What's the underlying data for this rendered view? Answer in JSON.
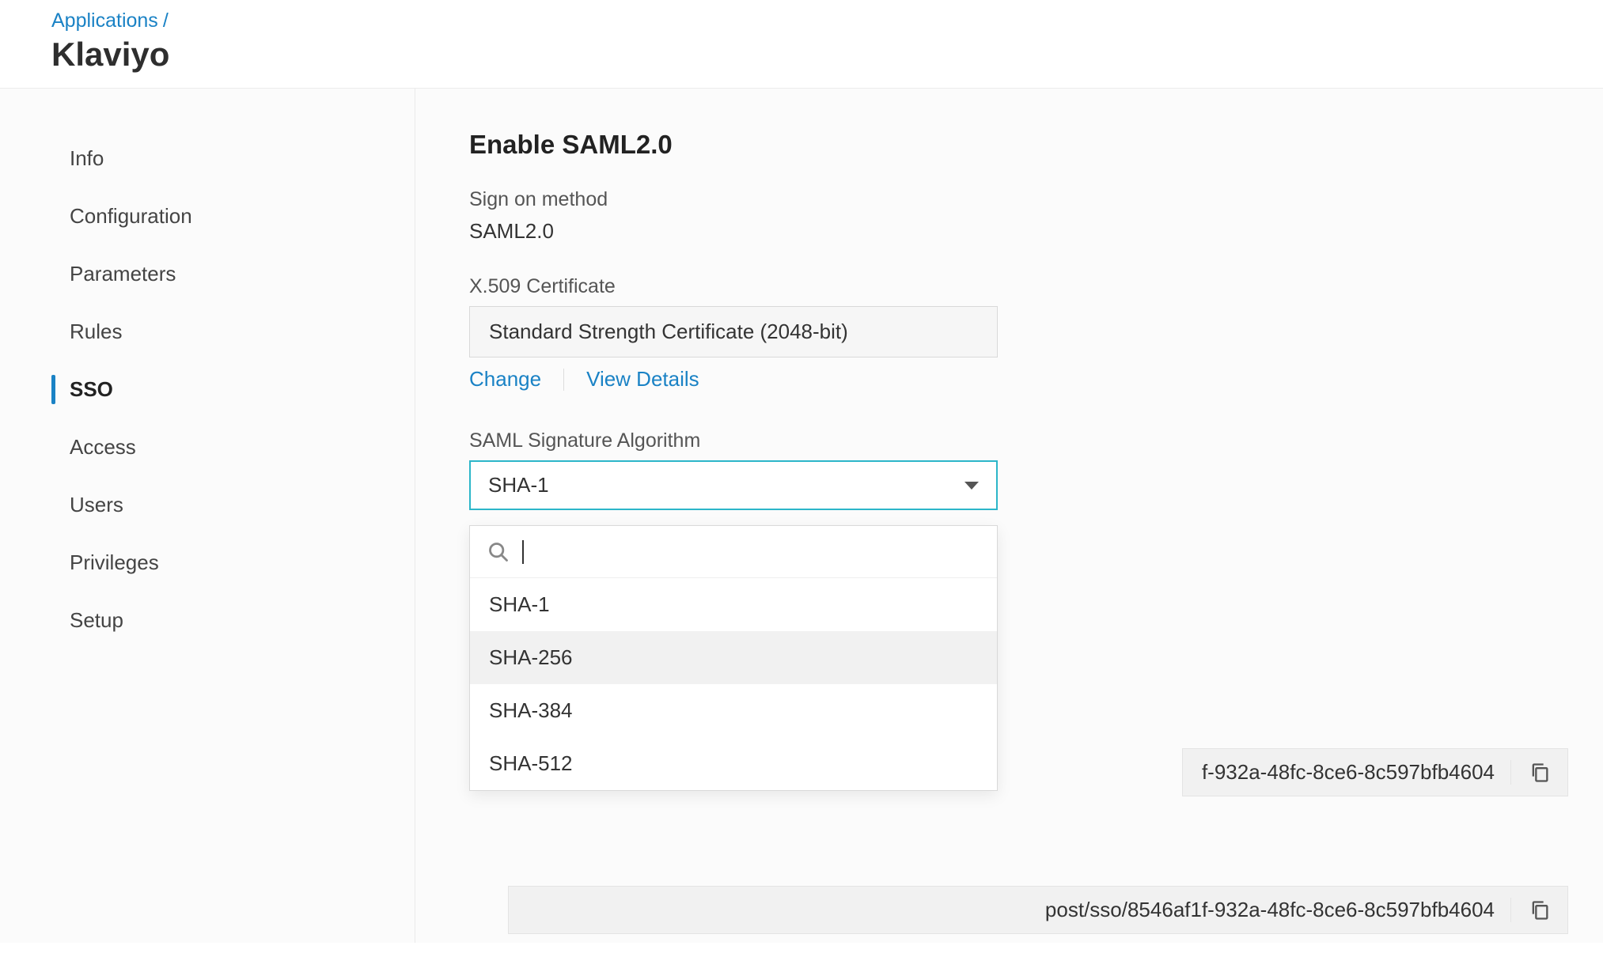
{
  "breadcrumb": {
    "parent": "Applications",
    "sep": "/"
  },
  "page_title": "Klaviyo",
  "sidebar": {
    "items": [
      {
        "label": "Info"
      },
      {
        "label": "Configuration"
      },
      {
        "label": "Parameters"
      },
      {
        "label": "Rules"
      },
      {
        "label": "SSO",
        "active": true
      },
      {
        "label": "Access"
      },
      {
        "label": "Users"
      },
      {
        "label": "Privileges"
      },
      {
        "label": "Setup"
      }
    ]
  },
  "main": {
    "section_title": "Enable SAML2.0",
    "sign_on_label": "Sign on method",
    "sign_on_value": "SAML2.0",
    "cert_label": "X.509 Certificate",
    "cert_value": "Standard Strength Certificate (2048-bit)",
    "cert_change": "Change",
    "cert_view": "View Details",
    "algo_label": "SAML Signature Algorithm",
    "algo_selected": "SHA-1",
    "algo_options": [
      "SHA-1",
      "SHA-256",
      "SHA-384",
      "SHA-512"
    ],
    "algo_hover_index": 1,
    "url1": "f-932a-48fc-8ce6-8c597bfb4604",
    "url2": "post/sso/8546af1f-932a-48fc-8ce6-8c597bfb4604"
  },
  "icons": {
    "search": "search-icon",
    "copy": "copy-icon",
    "caret": "caret-down-icon"
  }
}
